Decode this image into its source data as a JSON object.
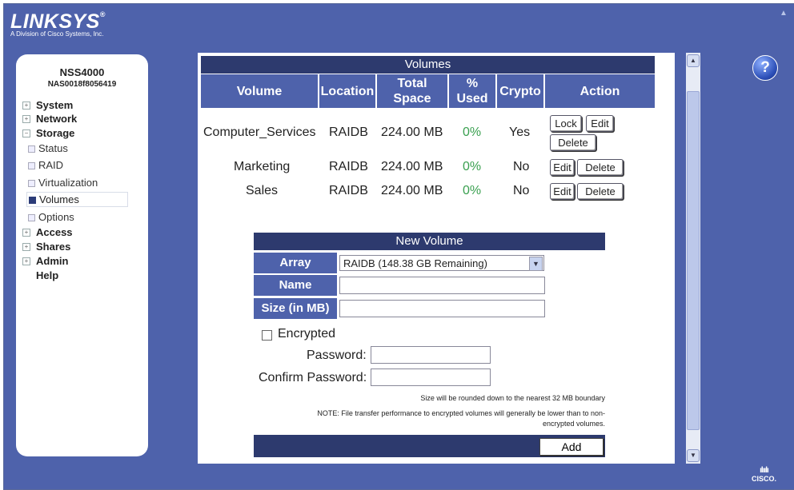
{
  "header": {
    "logo": "LINKSYS",
    "logo_mark": "®",
    "subtitle": "A Division of Cisco Systems, Inc."
  },
  "device": {
    "model": "NSS4000",
    "serial": "NAS0018f8056419"
  },
  "nav": {
    "system": "System",
    "network": "Network",
    "storage": "Storage",
    "storage_items": [
      "Status",
      "RAID",
      "Virtualization",
      "Volumes",
      "Options"
    ],
    "access": "Access",
    "shares": "Shares",
    "admin": "Admin",
    "help": "Help"
  },
  "volumes": {
    "title": "Volumes",
    "columns": [
      "Volume",
      "Location",
      "Total Space",
      "% Used",
      "Crypto",
      "Action"
    ],
    "col_total_a": "Total",
    "col_total_b": "Space",
    "col_used_a": "%",
    "col_used_b": "Used",
    "rows": [
      {
        "volume": "Computer_Services",
        "location": "RAIDB",
        "total": "224.00 MB",
        "used": "0%",
        "crypto": "Yes"
      },
      {
        "volume": "Marketing",
        "location": "RAIDB",
        "total": "224.00 MB",
        "used": "0%",
        "crypto": "No"
      },
      {
        "volume": "Sales",
        "location": "RAIDB",
        "total": "224.00 MB",
        "used": "0%",
        "crypto": "No"
      }
    ],
    "btn_lock": "Lock",
    "btn_edit": "Edit",
    "btn_delete": "Delete"
  },
  "new_volume": {
    "title": "New Volume",
    "array_label": "Array",
    "array_value": "RAIDB (148.38 GB Remaining)",
    "name_label": "Name",
    "size_label": "Size (in MB)",
    "encrypted_label": "Encrypted",
    "password_label": "Password:",
    "confirm_label": "Confirm Password:",
    "note_round": "Size will be rounded down to the nearest 32 MB boundary",
    "note_perf_1": "NOTE: File transfer performance to encrypted volumes will generally be lower than to non-",
    "note_perf_2": "encrypted volumes.",
    "add_label": "Add"
  },
  "help_glyph": "?",
  "footer": {
    "brand": "CISCO."
  },
  "colors": {
    "brand_blue": "#4e62ab",
    "dark_blue": "#2d3a6e",
    "green": "#3aa050"
  }
}
